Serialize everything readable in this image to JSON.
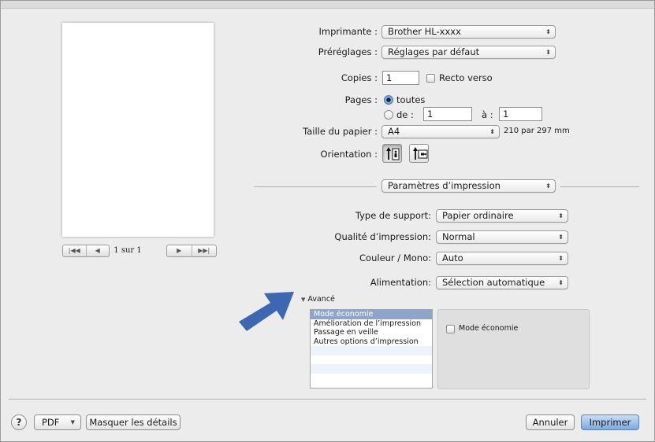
{
  "left": {
    "page_of": "1 sur 1"
  },
  "printer": {
    "label": "Imprimante :",
    "value": "Brother HL-xxxx"
  },
  "presets": {
    "label": "Préréglages :",
    "value": "Réglages par défaut"
  },
  "copies": {
    "label": "Copies :",
    "value": "1",
    "duplex_label": "Recto verso",
    "duplex_checked": false
  },
  "pages": {
    "label": "Pages :",
    "all_label": "toutes",
    "from_label": "de :",
    "from_value": "1",
    "to_label": "à :",
    "to_value": "1",
    "selected": "toutes"
  },
  "paper_size": {
    "label": "Taille du papier :",
    "value": "A4",
    "dimensions": "210 par 297 mm"
  },
  "orientation": {
    "label": "Orientation :",
    "selected": "portrait"
  },
  "section": {
    "value": "Paramètres d’impression"
  },
  "media_type": {
    "label": "Type de support:",
    "value": "Papier ordinaire"
  },
  "print_quality": {
    "label": "Qualité d’impression:",
    "value": "Normal"
  },
  "color_mono": {
    "label": "Couleur / Mono:",
    "value": "Auto"
  },
  "paper_source": {
    "label": "Alimentation:",
    "value": "Sélection automatique"
  },
  "advanced": {
    "toggle_label": "Avancé",
    "items": [
      "Mode économie",
      "Amélioration de l’impression",
      "Passage en veille",
      "Autres options d’impression"
    ],
    "selected_index": 0,
    "option_label": "Mode économie",
    "option_checked": false
  },
  "footer": {
    "help": "?",
    "pdf": "PDF",
    "hide_details": "Masquer les détails",
    "cancel": "Annuler",
    "print": "Imprimer"
  },
  "colors": {
    "accent": "#3d67b1",
    "selection": "#8ea5c9",
    "dialog_bg": "#ececec"
  }
}
